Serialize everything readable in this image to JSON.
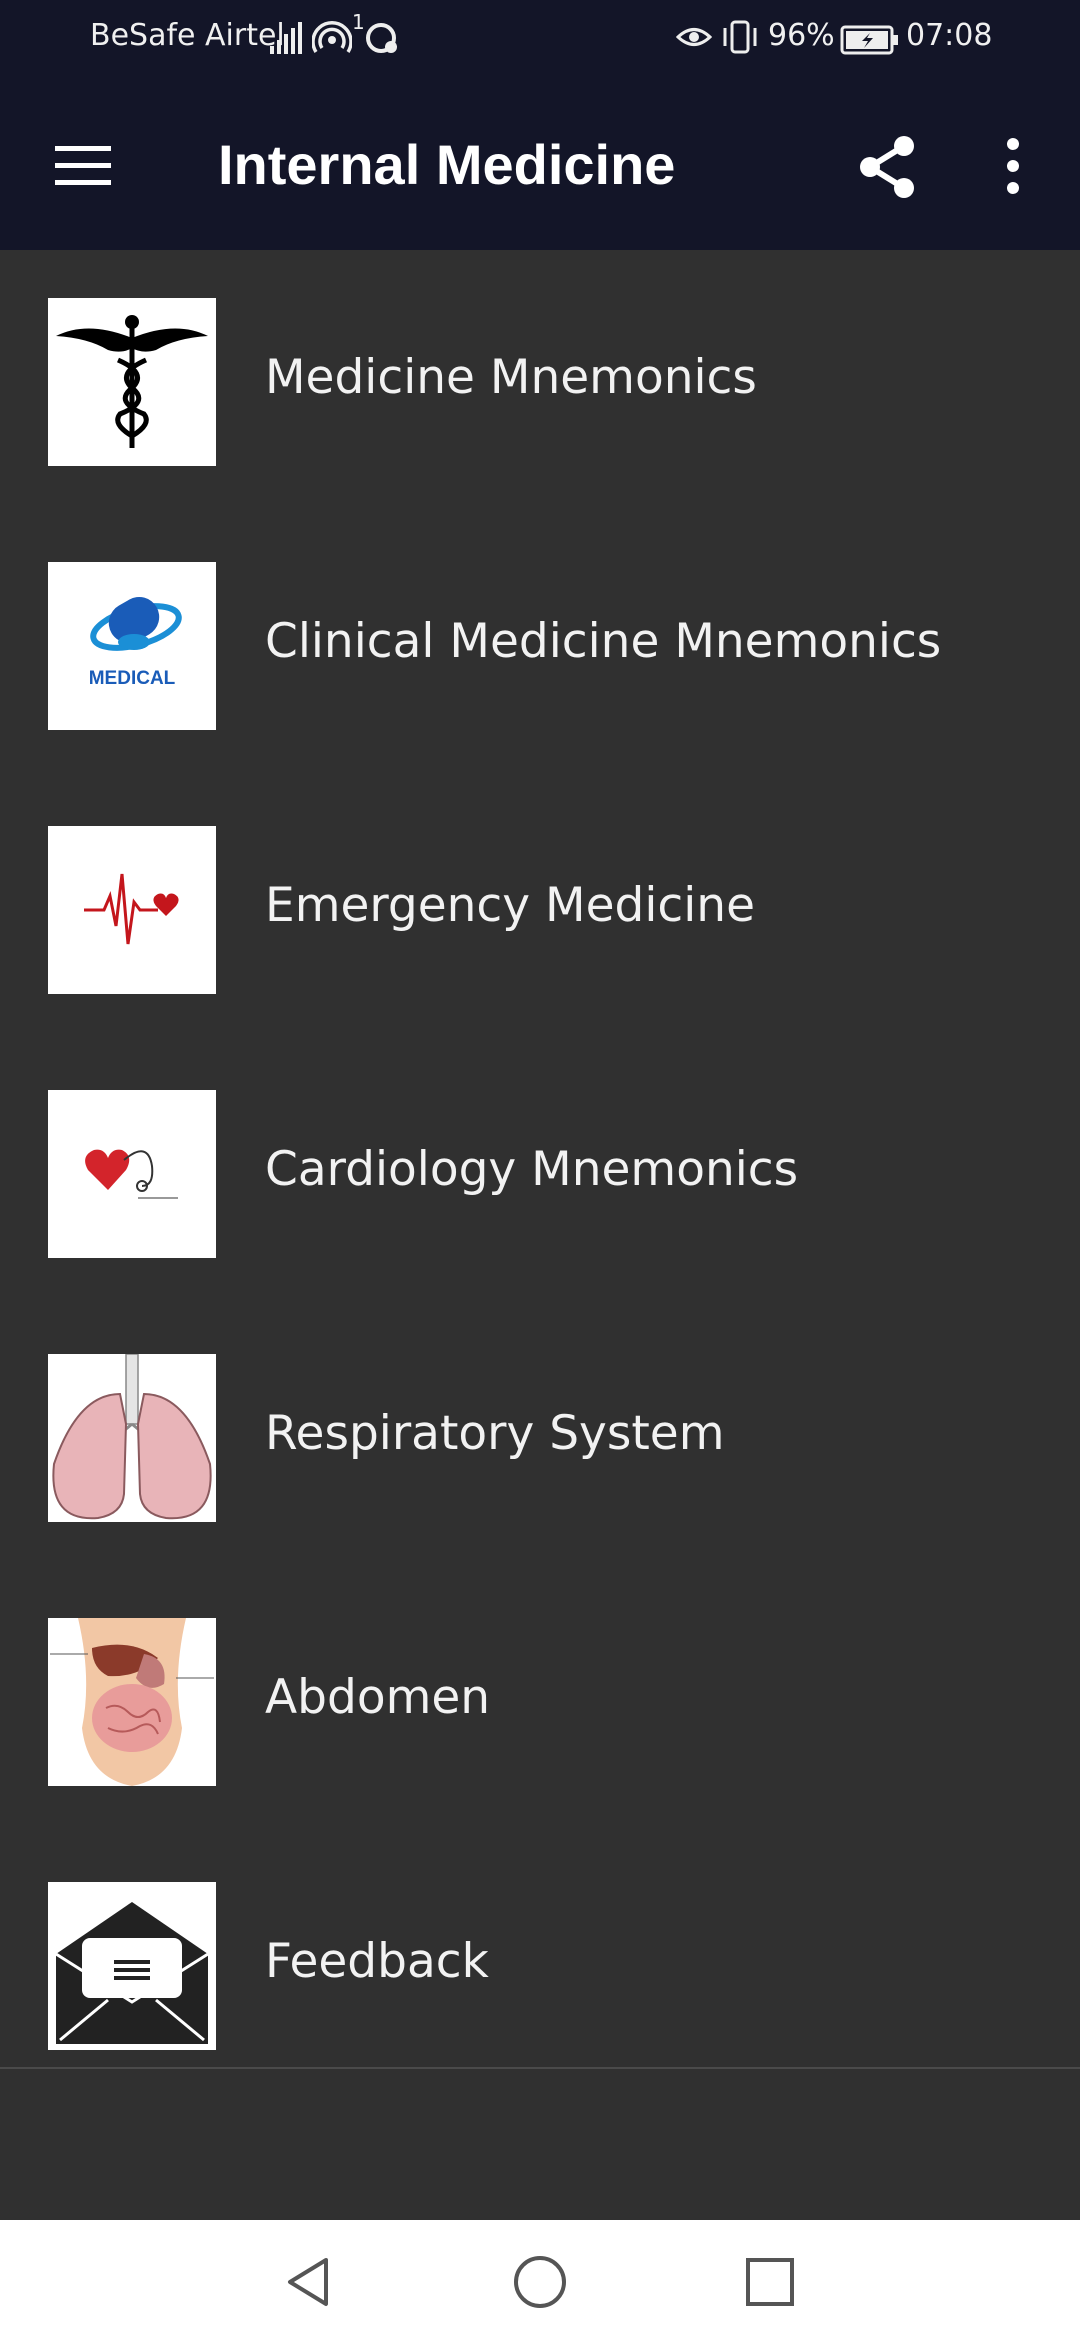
{
  "status_bar": {
    "carrier": "BeSafe Airtel",
    "battery_percent": "96%",
    "time": "07:08",
    "sim_badge": "1"
  },
  "app_bar": {
    "title": "Internal Medicine",
    "menu_icon": "hamburger-icon",
    "share_icon": "share-icon",
    "more_icon": "more-vert-icon"
  },
  "menu": {
    "items": [
      {
        "label": "Medicine Mnemonics",
        "icon": "caduceus-icon"
      },
      {
        "label": "Clinical Medicine Mnemonics",
        "icon": "medical-logo-icon",
        "logo_text": "MEDICAL"
      },
      {
        "label": "Emergency Medicine",
        "icon": "heartbeat-icon"
      },
      {
        "label": "Cardiology Mnemonics",
        "icon": "heart-stethoscope-icon"
      },
      {
        "label": "Respiratory System",
        "icon": "lungs-icon"
      },
      {
        "label": "Abdomen",
        "icon": "abdomen-anatomy-icon"
      },
      {
        "label": "Feedback",
        "icon": "envelope-icon"
      }
    ]
  },
  "nav_bar": {
    "back_icon": "back-icon",
    "home_icon": "home-icon",
    "recents_icon": "recents-icon"
  },
  "colors": {
    "app_bar_bg": "#131528",
    "list_bg": "#303030",
    "nav_bg": "#ffffff"
  }
}
